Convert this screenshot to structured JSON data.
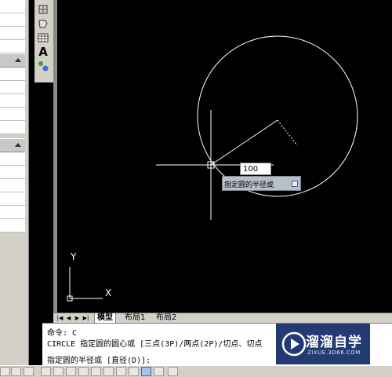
{
  "drawing": {
    "radius_input": "100",
    "tooltip": "指定圆的半径或"
  },
  "ucs": {
    "x_label": "X",
    "y_label": "Y"
  },
  "tabs": [
    {
      "label": "模型",
      "active": true
    },
    {
      "label": "布局1",
      "active": false
    },
    {
      "label": "布局2",
      "active": false
    }
  ],
  "command": {
    "history1": "命令: C",
    "history2": "CIRCLE 指定圆的圆心或 [三点(3P)/两点(2P)/切点、切点",
    "prompt": "指定圆的半径或 [直径(D)]:"
  },
  "toolbar": {
    "text_tool_glyph": "A"
  },
  "watermark": {
    "brand": "溜溜自学",
    "url": "ZIXUE.3D66.COM"
  },
  "colors": {
    "canvas": "#000000",
    "entity": "#ffffff",
    "watermark_bg": "#243a73"
  }
}
